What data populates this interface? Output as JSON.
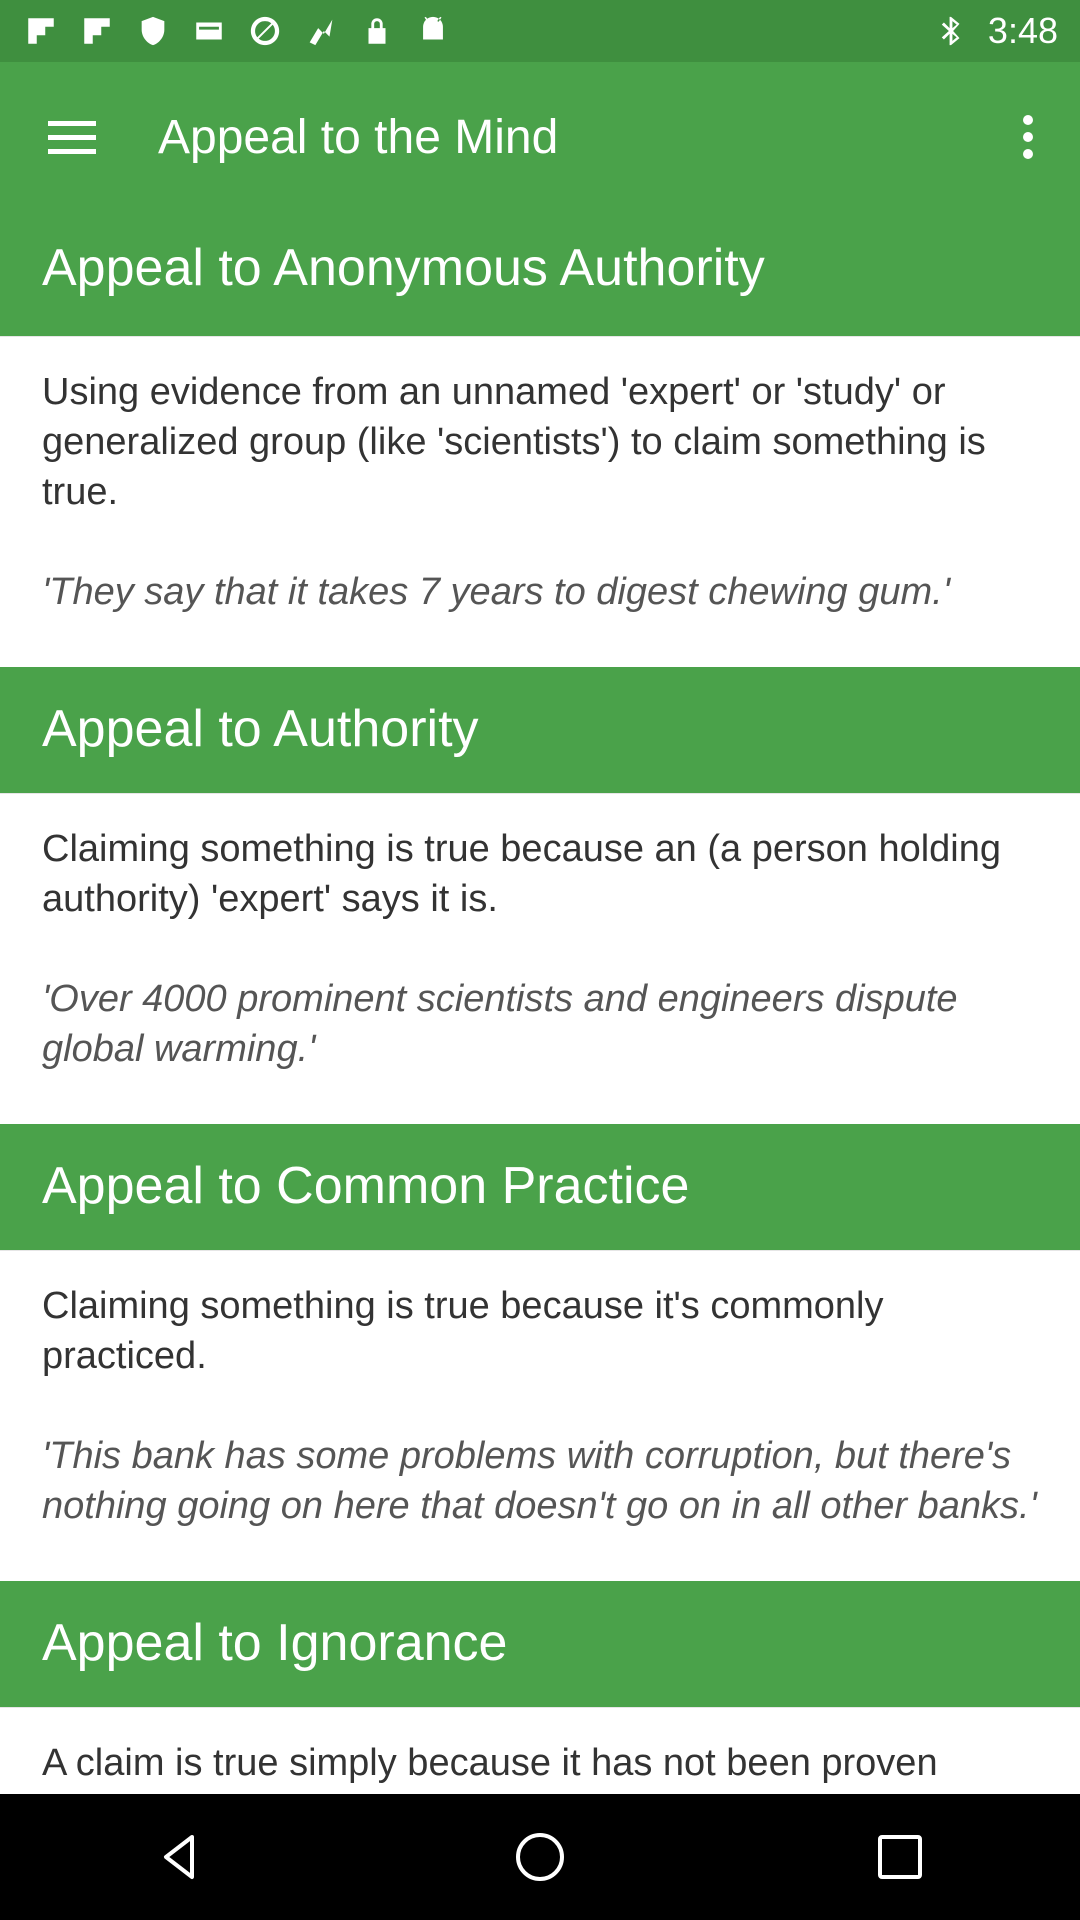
{
  "status_bar": {
    "time": "3:48",
    "left_icons": [
      "flipboard-icon",
      "flipboard-icon",
      "shield-icon",
      "message-icon",
      "no-signal-icon",
      "fake-gps-icon",
      "lock-icon",
      "android-icon"
    ],
    "right_icons": [
      "bluetooth-icon"
    ]
  },
  "app_bar": {
    "title": "Appeal to the Mind",
    "background": "#4aa24a"
  },
  "sections": [
    {
      "title": "Appeal to Anonymous Authority",
      "description": "Using evidence from an unnamed 'expert' or 'study' or generalized group (like 'scientists') to claim something is true.",
      "example": "'They say that it takes 7 years to digest chewing gum.'"
    },
    {
      "title": "Appeal to Authority",
      "description": "Claiming something is true because an (a person holding authority) 'expert' says it is.",
      "example": "'Over 4000 prominent scientists and engineers dispute global warming.'"
    },
    {
      "title": "Appeal to Common Practice",
      "description": "Claiming something is true because it's commonly practiced.",
      "example": "'This bank has some problems with corruption, but there's nothing going on here that doesn't go on in all other banks.'"
    },
    {
      "title": "Appeal to Ignorance",
      "description": "A claim is true simply because it has not been proven"
    }
  ],
  "nav_bar": {
    "buttons": [
      "back-icon",
      "home-icon",
      "recents-icon"
    ]
  }
}
